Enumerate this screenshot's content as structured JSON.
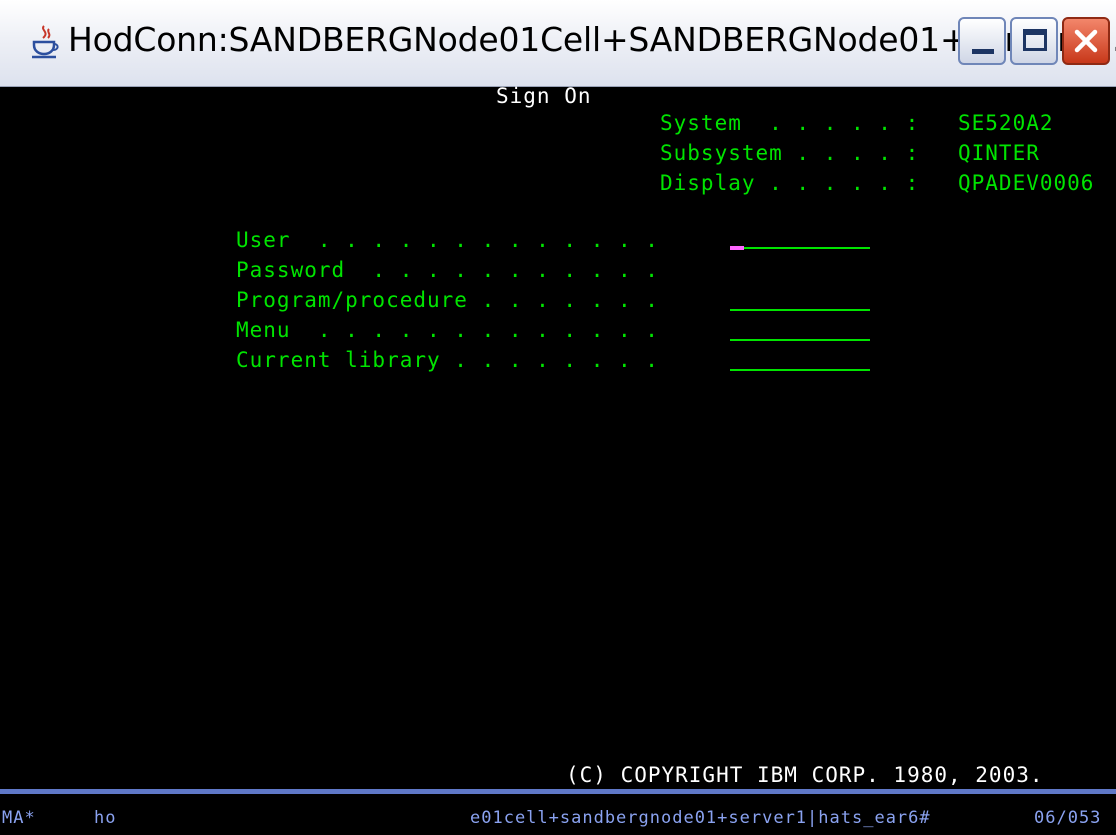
{
  "window": {
    "title": "HodConn:SANDBERGNode01Cell+SANDBERGNode01+server1...",
    "icon": "java-coffee-icon",
    "buttons": {
      "minimize": "minimize-icon",
      "maximize": "maximize-icon",
      "close": "close-icon"
    }
  },
  "screen": {
    "heading": "Sign On",
    "system_info": [
      {
        "label": "System  . . . . . :",
        "value": "SE520A2"
      },
      {
        "label": "Subsystem . . . . :",
        "value": "QINTER"
      },
      {
        "label": "Display . . . . . :",
        "value": "QPADEV0006"
      }
    ],
    "fields": [
      {
        "label": "User  . . . . . . . . . . . . .",
        "value": ""
      },
      {
        "label": "Password  . . . . . . . . . . .",
        "value": ""
      },
      {
        "label": "Program/procedure . . . . . . .",
        "value": ""
      },
      {
        "label": "Menu  . . . . . . . . . . . . .",
        "value": ""
      },
      {
        "label": "Current library . . . . . . . .",
        "value": ""
      }
    ],
    "copyright": "(C) COPYRIGHT IBM CORP. 1980, 2003."
  },
  "status_bar": {
    "indicator": "MA*",
    "mode": "ho",
    "session": "e01cell+sandbergnode01+server1|hats_ear6#",
    "cursor_pos": "06/053"
  },
  "colors": {
    "text_green": "#00e400",
    "text_white": "#ffffff",
    "status_blue": "#8aa2f0",
    "cursor": "#ff66ff"
  }
}
